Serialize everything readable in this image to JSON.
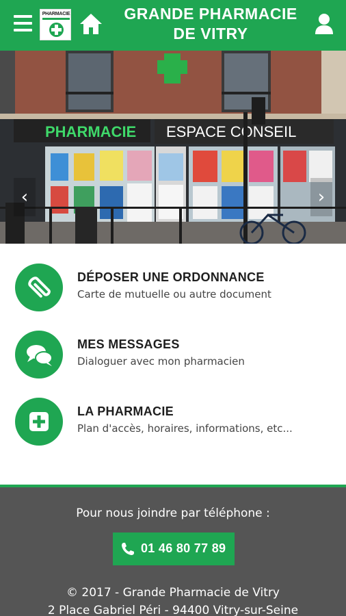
{
  "header": {
    "title_line1": "GRANDE PHARMACIE",
    "title_line2": "DE VITRY",
    "logo_text": "PHARMACIE",
    "icons": {
      "menu": "hamburger-menu-icon",
      "home": "home-icon",
      "user": "user-icon"
    }
  },
  "banner": {
    "sign_pharmacie": "PHARMACIE",
    "sign_espace": "ESPACE CONSEIL",
    "icons": {
      "prev": "chevron-left-icon",
      "next": "chevron-right-icon"
    }
  },
  "menu": {
    "items": [
      {
        "title": "DÉPOSER UNE ORDONNANCE",
        "subtitle": "Carte de mutuelle ou autre document",
        "icon": "paperclip-icon"
      },
      {
        "title": "MES MESSAGES",
        "subtitle": "Dialoguer avec mon pharmacien",
        "icon": "chat-bubbles-icon"
      },
      {
        "title": "LA PHARMACIE",
        "subtitle": "Plan d'accès, horaires, informations, etc...",
        "icon": "plus-square-icon"
      }
    ]
  },
  "footer": {
    "phone_label": "Pour nous joindre par téléphone :",
    "phone_number": "01 46 80 77 89",
    "copyright": "© 2017 - Grande Pharmacie de Vitry",
    "address": "2 Place Gabriel Péri - 94400 Vitry-sur-Seine",
    "icon": "phone-icon"
  },
  "colors": {
    "brand_green": "#1fa652",
    "footer_gray": "#555555",
    "text_dark": "#1e1e1e"
  }
}
